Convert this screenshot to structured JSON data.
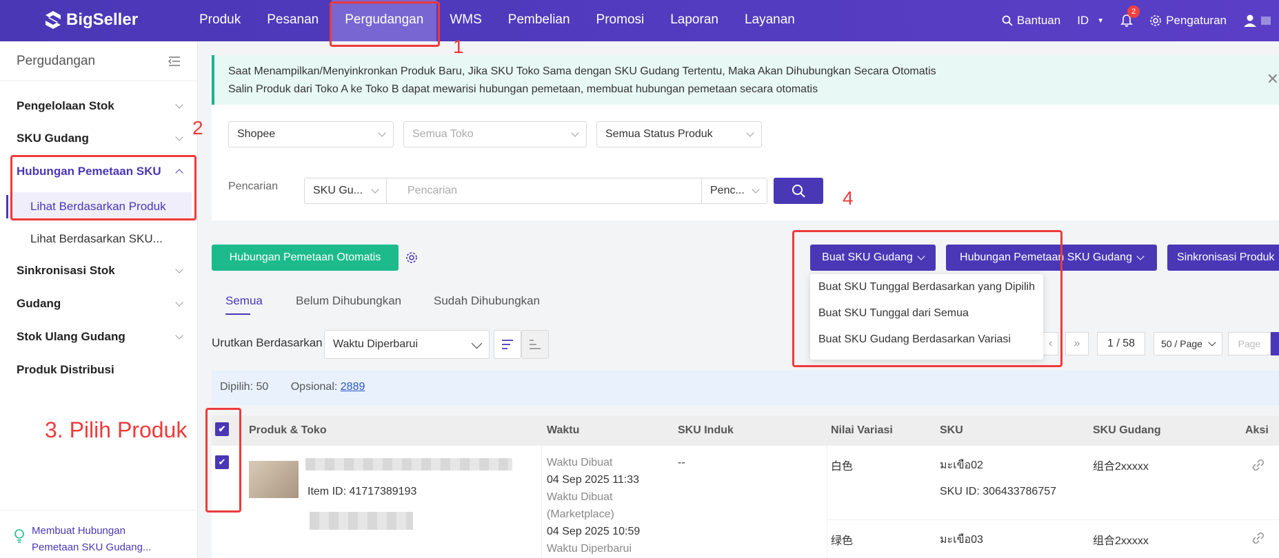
{
  "app": {
    "logo_text": "BigSeller",
    "brand_color": "#4a37b6"
  },
  "nav": {
    "items": [
      "Produk",
      "Pesanan",
      "Pergudangan",
      "WMS",
      "Pembelian",
      "Promosi",
      "Laporan",
      "Layanan"
    ],
    "active": "Pergudangan"
  },
  "topright": {
    "help": "Bantuan",
    "lang": "ID",
    "notif_count": "2",
    "settings": "Pengaturan"
  },
  "annotations": {
    "n1": "1",
    "n2": "2",
    "n3": "3. Pilih Produk",
    "n4": "4"
  },
  "sidebar": {
    "title": "Pergudangan",
    "items": [
      "Pengelolaan Stok",
      "SKU Gudang",
      "Hubungan Pemetaan SKU",
      "Sinkronisasi Stok",
      "Gudang",
      "Stok Ulang Gudang",
      "Produk Distribusi"
    ],
    "sub_items": [
      "Lihat Berdasarkan Produk",
      "Lihat Berdasarkan SKU..."
    ],
    "footer_line1": "Membuat Hubungan",
    "footer_line2": "Pemetaan SKU Gudang..."
  },
  "notice": {
    "line1": "Saat Menampilkan/Menyinkronkan Produk Baru, Jika SKU Toko Sama dengan SKU Gudang Tertentu, Maka Akan Dihubungkan Secara Otomatis",
    "line2": "Salin Produk dari Toko A ke Toko B dapat mewarisi hubungan pemetaan, membuat hubungan pemetaan secara otomatis"
  },
  "filters": {
    "platform": "Shopee",
    "store_placeholder": "Semua Toko",
    "status": "Semua Status Produk"
  },
  "search": {
    "label": "Pencarian",
    "field": "SKU Gu...",
    "placeholder": "Pencarian",
    "mode": "Penc..."
  },
  "actions": {
    "auto_map": "Hubungan Pemetaan Otomatis",
    "create_sku": "Buat SKU Gudang",
    "map_sku": "Hubungan Pemetaan SKU Gudang",
    "sync": "Sinkronisasi Produk"
  },
  "dropdown": {
    "items": [
      "Buat SKU Tunggal Berdasarkan yang Dipilih",
      "Buat SKU Tunggal dari Semua",
      "Buat SKU Gudang Berdasarkan Variasi"
    ]
  },
  "tabs": [
    "Semua",
    "Belum Dihubungkan",
    "Sudah Dihubungkan"
  ],
  "sort": {
    "label": "Urutkan Berdasarkan",
    "value": "Waktu Diperbarui"
  },
  "pagination": {
    "page": "1 / 58",
    "per_page": "50 / Page",
    "page_placeholder": "Page"
  },
  "selection": {
    "selected": "Dipilih: 50",
    "optional_label": "Opsional:",
    "optional_count": "2889"
  },
  "table": {
    "headers": [
      "Produk & Toko",
      "Waktu",
      "SKU Induk",
      "Nilai Variasi",
      "SKU",
      "SKU Gudang",
      "Aksi"
    ],
    "row": {
      "item_id": "Item ID: 41717389193",
      "time_lines": [
        "Waktu Dibuat",
        "04 Sep 2025 11:33",
        "Waktu Dibuat",
        "(Marketplace)",
        "04 Sep 2025 10:59",
        "Waktu Diperbarui"
      ],
      "parent_sku": "--",
      "variants": [
        {
          "value": "白色",
          "sku": "มะเขือ02",
          "sku_id": "SKU ID: 306433786757",
          "warehouse_sku": "组合2xxxxx"
        },
        {
          "value": "绿色",
          "sku": "มะเขือ03",
          "warehouse_sku": "组合2xxxxx"
        }
      ]
    }
  }
}
